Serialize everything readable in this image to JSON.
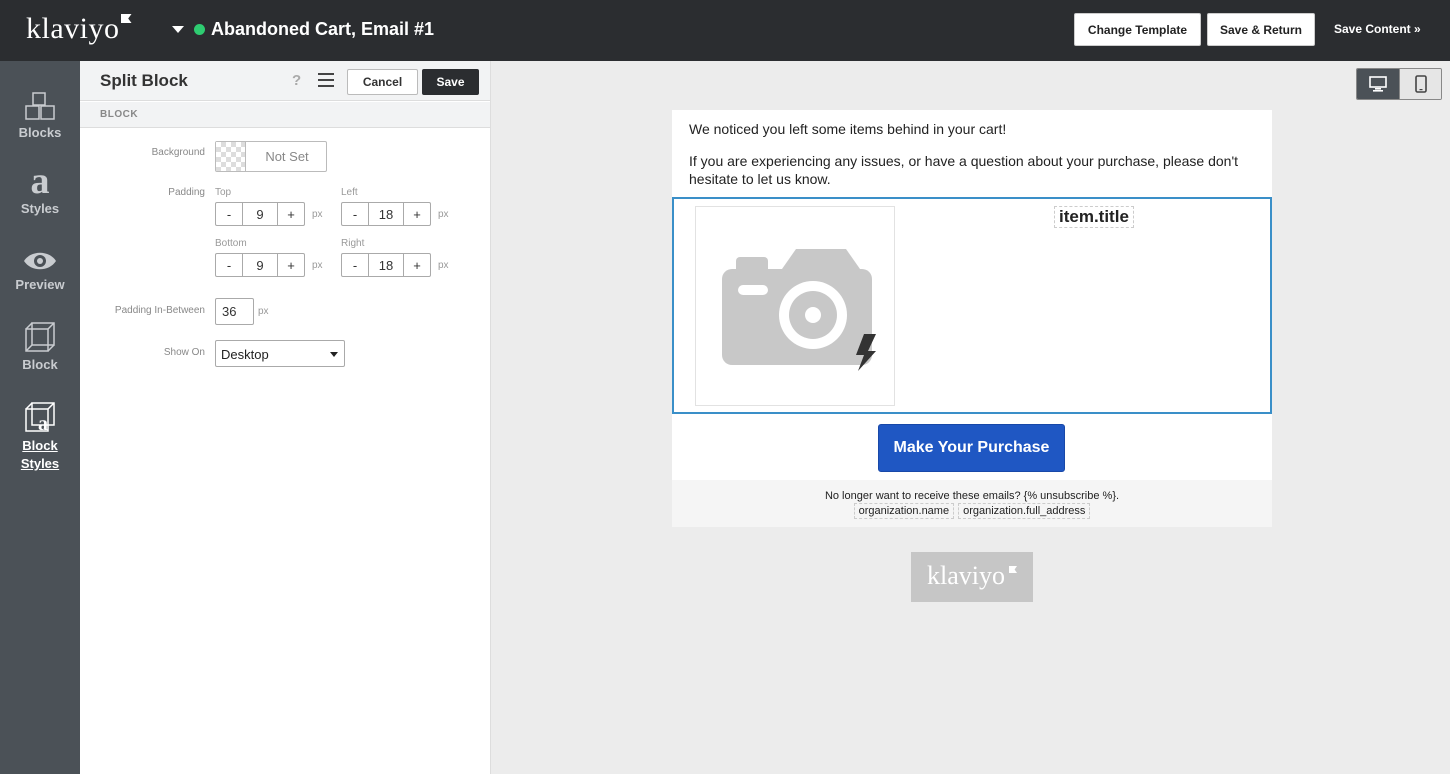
{
  "app": {
    "logo": "klaviyo",
    "email_title": "Abandoned Cart, Email #1",
    "status_color": "#2ecc71"
  },
  "toolbar": {
    "change_template": "Change Template",
    "save_return": "Save & Return",
    "save_content": "Save Content »"
  },
  "nav": {
    "items": [
      {
        "label": "Blocks",
        "icon": "blocks-icon"
      },
      {
        "label": "Styles",
        "icon": "styles-icon"
      },
      {
        "label": "Preview",
        "icon": "eye-icon"
      },
      {
        "label": "Block",
        "icon": "cube-icon"
      },
      {
        "label": "Block Styles",
        "icon": "block-styles-icon",
        "active": true
      }
    ]
  },
  "panel": {
    "title": "Split Block",
    "help": "?",
    "cancel": "Cancel",
    "save": "Save",
    "section": "BLOCK",
    "background_label": "Background",
    "background_value": "Not Set",
    "padding_label": "Padding",
    "padding": {
      "top_label": "Top",
      "top": "9",
      "left_label": "Left",
      "left": "18",
      "bottom_label": "Bottom",
      "bottom": "9",
      "right_label": "Right",
      "right": "18",
      "minus": "-",
      "plus": "+",
      "unit": "px"
    },
    "padding_between_label": "Padding In-Between",
    "padding_between": "36",
    "show_on_label": "Show On",
    "show_on": "Desktop"
  },
  "email": {
    "line1": "We noticed you left some items behind in your cart!",
    "line2": "If you are experiencing any issues, or have a question about your purchase, please don't hesitate to let us know.",
    "item_title": "item.title",
    "cta": "Make Your Purchase",
    "cta_color": "#1f57c3",
    "unsubscribe": "No longer want to receive these emails? {% unsubscribe %}.",
    "org_name": "organization.name",
    "org_address": "organization.full_address",
    "footer_logo": "klaviyo"
  }
}
